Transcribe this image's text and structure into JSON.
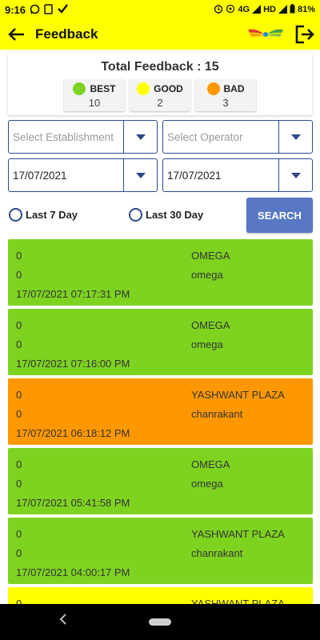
{
  "status_bar": {
    "time": "9:16",
    "signal": "4G",
    "network": "HD",
    "battery": "81%"
  },
  "app_bar": {
    "title": "Feedback"
  },
  "summary": {
    "title": "Total Feedback : 15",
    "counts": [
      {
        "label": "BEST",
        "value": "10",
        "color": "#7ed321"
      },
      {
        "label": "GOOD",
        "value": "2",
        "color": "#ffff00"
      },
      {
        "label": "BAD",
        "value": "3",
        "color": "#ff9800"
      }
    ]
  },
  "filters": {
    "establishment_placeholder": "Select Establishment",
    "operator_placeholder": "Select Operator",
    "from_date": "17/07/2021",
    "to_date": "17/07/2021",
    "radio_last7": "Last 7 Day",
    "radio_last30": "Last 30 Day",
    "search_label": "SEARCH"
  },
  "feedback": [
    {
      "rating": "0",
      "establishment": "OMEGA",
      "number": "0",
      "operator": "omega",
      "time": "17/07/2021 07:17:31 PM",
      "color": "#7ed321"
    },
    {
      "rating": "0",
      "establishment": "OMEGA",
      "number": "0",
      "operator": "omega",
      "time": "17/07/2021 07:16:00 PM",
      "color": "#7ed321"
    },
    {
      "rating": "0",
      "establishment": "YASHWANT PLAZA",
      "number": "0",
      "operator": "chanrakant",
      "time": "17/07/2021 06:18:12 PM",
      "color": "#ff9800"
    },
    {
      "rating": "0",
      "establishment": "OMEGA",
      "number": "0",
      "operator": "omega",
      "time": "17/07/2021 05:41:58 PM",
      "color": "#7ed321"
    },
    {
      "rating": "0",
      "establishment": "YASHWANT PLAZA",
      "number": "0",
      "operator": "chanrakant",
      "time": "17/07/2021 04:00:17 PM",
      "color": "#7ed321"
    },
    {
      "rating": "0",
      "establishment": "YASHWANT PLAZA",
      "number": "",
      "operator": "",
      "time": "",
      "color": "#ffff00"
    }
  ]
}
